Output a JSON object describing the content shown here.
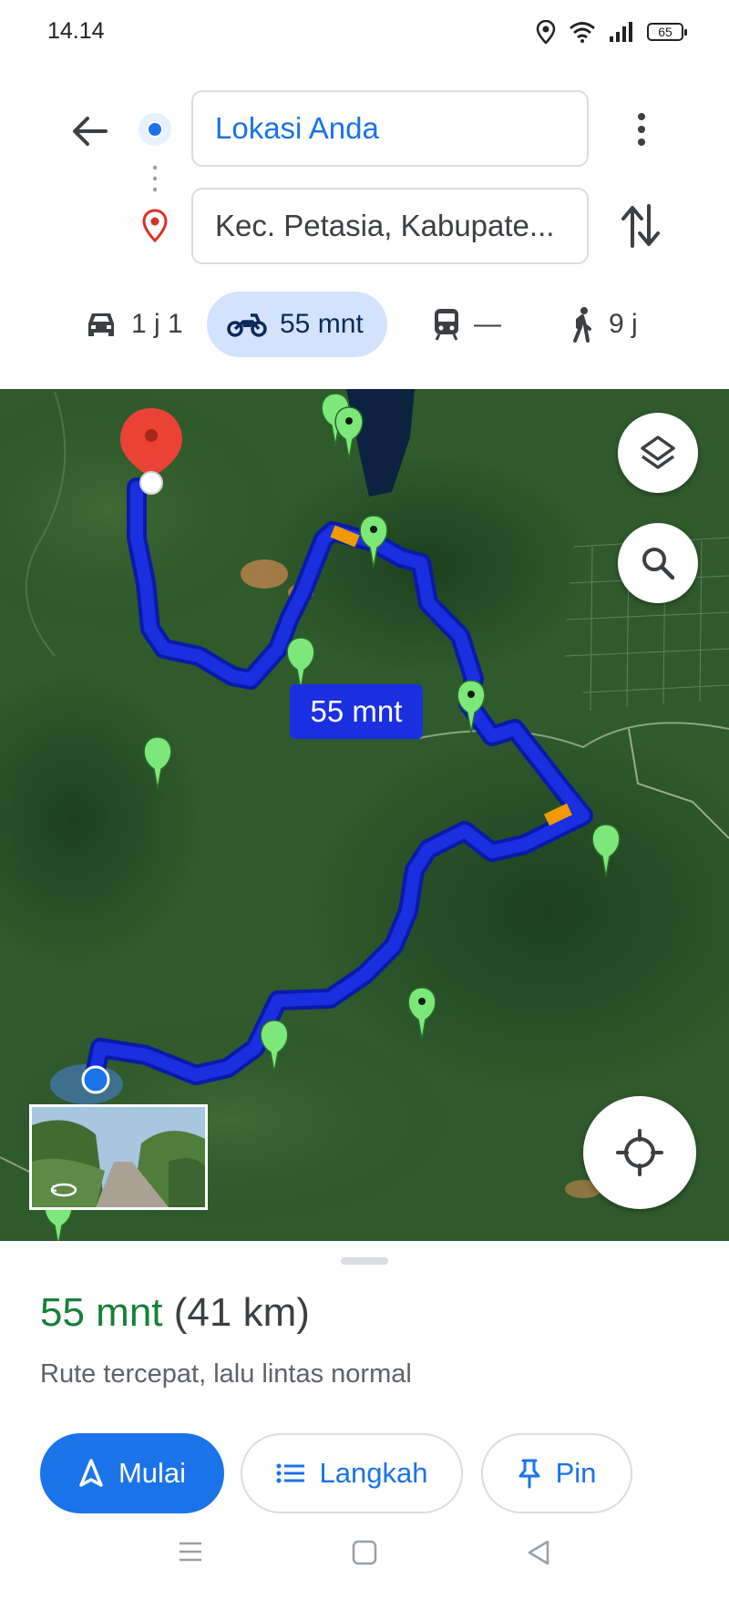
{
  "status_bar": {
    "time": "14.14",
    "battery": "65"
  },
  "directions": {
    "origin": "Lokasi Anda",
    "destination": "Kec. Petasia, Kabupate..."
  },
  "modes": [
    {
      "icon": "car-icon",
      "label": "1 j 1"
    },
    {
      "icon": "motorcycle-icon",
      "label": "55 mnt",
      "selected": true
    },
    {
      "icon": "transit-icon",
      "label": "—"
    },
    {
      "icon": "walk-icon",
      "label": "9 j"
    }
  ],
  "map": {
    "route_label": "55 mnt",
    "route_color": "#1a2fe0"
  },
  "summary": {
    "duration": "55 mnt",
    "distance": "(41 km)",
    "description": "Rute tercepat, lalu lintas normal"
  },
  "actions": {
    "start": "Mulai",
    "steps": "Langkah",
    "pin": "Pin"
  },
  "colors": {
    "accent": "#1a73e8",
    "duration_green": "#188038",
    "chip_selected": "#d3e3fd"
  }
}
